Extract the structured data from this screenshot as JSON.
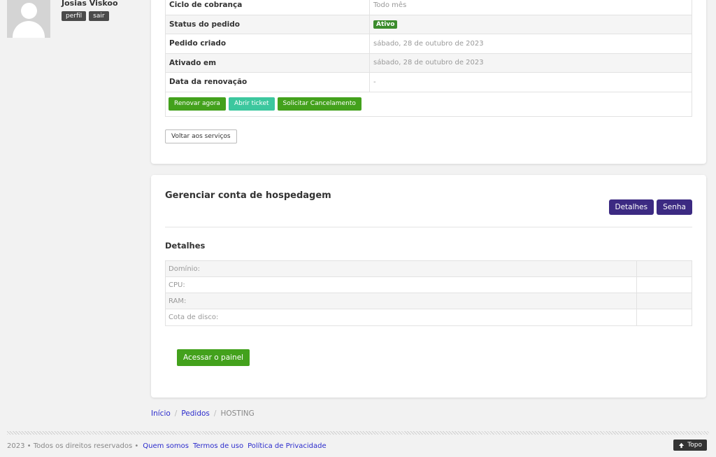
{
  "user": {
    "name": "Josias Viskoo",
    "profile_label": "perfil",
    "logout_label": "sair"
  },
  "order": {
    "rows": [
      {
        "label": "Ciclo de cobrança",
        "value": "Todo mês"
      },
      {
        "label": "Status do pedido",
        "value": "Ativo"
      },
      {
        "label": "Pedido criado",
        "value": "sábado, 28 de outubro de 2023"
      },
      {
        "label": "Ativado em",
        "value": "sábado, 28 de outubro de 2023"
      },
      {
        "label": "Data da renovação",
        "value": "-"
      }
    ],
    "renew_label": "Renovar agora",
    "ticket_label": "Abrir ticket",
    "cancel_label": "Solicitar Cancelamento",
    "back_label": "Voltar aos serviços"
  },
  "manage": {
    "title": "Gerenciar conta de hospedagem",
    "details_btn": "Detalhes",
    "password_btn": "Senha",
    "details_title": "Detalhes",
    "details_rows": [
      {
        "label": "Domínio:",
        "value": ""
      },
      {
        "label": "CPU:",
        "value": ""
      },
      {
        "label": "RAM:",
        "value": ""
      },
      {
        "label": "Cota de disco:",
        "value": ""
      }
    ],
    "panel_btn": "Acessar o painel"
  },
  "breadcrumb": {
    "home": "Início",
    "orders": "Pedidos",
    "current": "HOSTING",
    "separator": "/"
  },
  "footer": {
    "copyright": "2023 • Todos os direitos reservados •",
    "about": "Quem somos",
    "terms": "Termos de uso",
    "privacy": "Política de Privacidade",
    "top_label": "Topo"
  },
  "colors": {
    "green": "#43a11c",
    "teal": "#3cc79e",
    "purple": "#3c2a82",
    "link": "#2b2bcc"
  }
}
